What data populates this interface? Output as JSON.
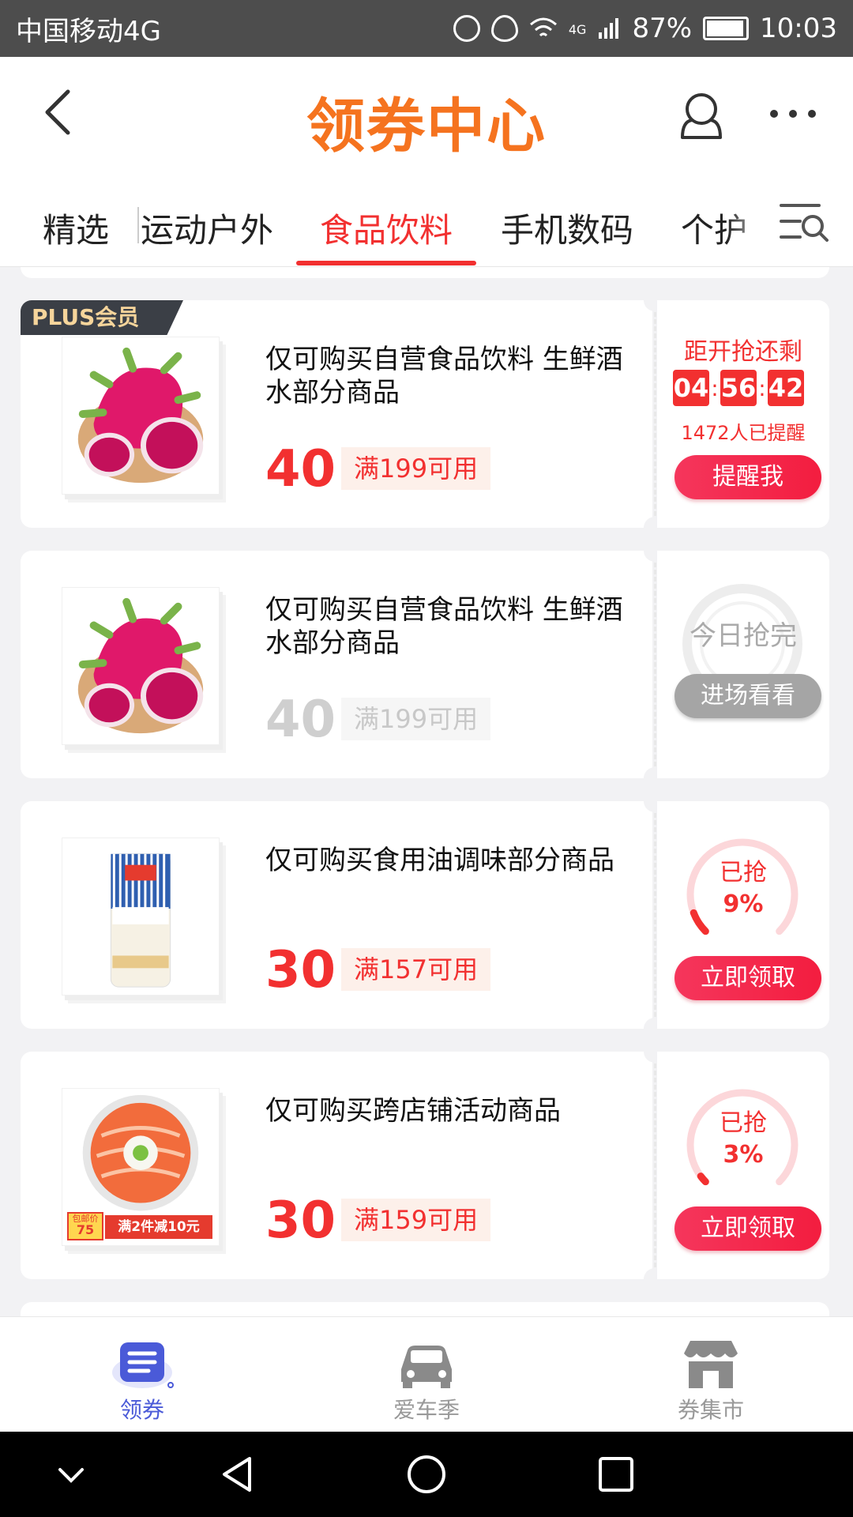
{
  "status_bar": {
    "carrier": "中国移动4G",
    "network_type": "4G",
    "battery": "87%",
    "time": "10:03"
  },
  "header": {
    "title": "领券中心"
  },
  "tabs": [
    "精选",
    "运动户外",
    "食品饮料",
    "手机数码",
    "个护"
  ],
  "active_tab": 2,
  "coupons": [
    {
      "badge": "PLUS会员",
      "desc": "仅可购买自营食品饮料 生鲜酒水部分商品",
      "amount": "40",
      "condition": "满199可用",
      "countdown_label": "距开抢还剩",
      "timer": [
        "04",
        "56",
        "42"
      ],
      "reminded": "1472人已提醒",
      "button": "提醒我"
    },
    {
      "desc": "仅可购买自营食品饮料 生鲜酒水部分商品",
      "amount": "40",
      "condition": "满199可用",
      "status": "今日抢完",
      "button": "进场看看"
    },
    {
      "desc": "仅可购买食用油调味部分商品",
      "amount": "30",
      "condition": "满157可用",
      "grabbed_label": "已抢",
      "grabbed_percent": "9%",
      "grabbed_fraction": 0.09,
      "button": "立即领取"
    },
    {
      "desc": "仅可购买跨店铺活动商品",
      "amount": "30",
      "condition": "满159可用",
      "product_tags": {
        "price_label": "包邮价",
        "price": "75",
        "promo": "满2件减10元"
      },
      "grabbed_label": "已抢",
      "grabbed_percent": "3%",
      "grabbed_fraction": 0.03,
      "button": "立即领取"
    }
  ],
  "bottom_nav": [
    {
      "label": "领券",
      "active": true
    },
    {
      "label": "爱车季",
      "active": false
    },
    {
      "label": "券集市",
      "active": false
    }
  ],
  "colors": {
    "accent": "#f23030",
    "title": "#f5731f",
    "nav_active": "#4a5ad8"
  }
}
